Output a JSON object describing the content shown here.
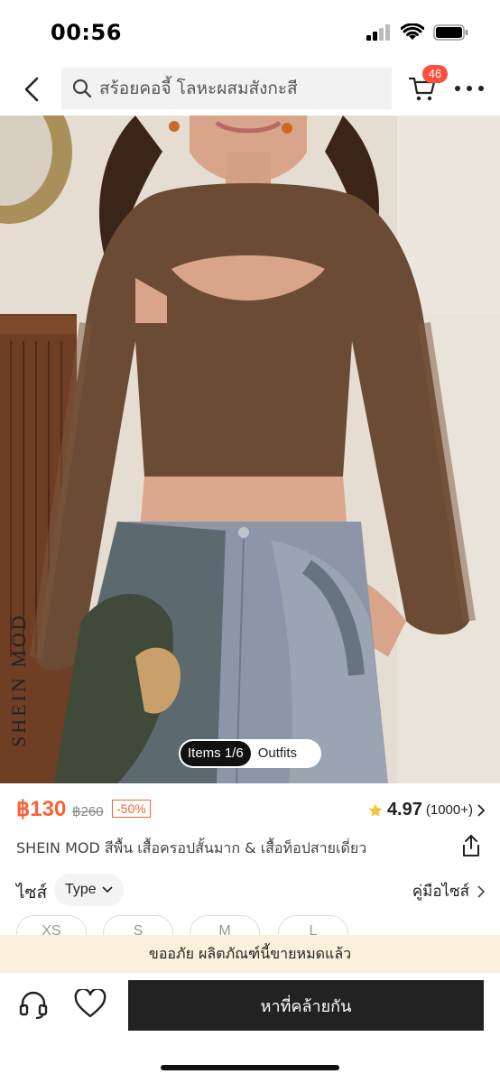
{
  "status_bar": {
    "time": "00:56"
  },
  "nav": {
    "search_placeholder": "สร้อยคอจี้ โลหะผสมสังกะสี",
    "cart_count": "46"
  },
  "hero": {
    "brand_watermark": "SHEIN MOD",
    "toggle_items": "Items 1/6",
    "toggle_outfits": "Outfits"
  },
  "product": {
    "price": "฿130",
    "original_price": "฿260",
    "discount": "-50%",
    "rating": "4.97",
    "review_count": "(1000+)",
    "title": "SHEIN MOD สีพื้น เสื้อครอปสั้นมาก & เสื้อท็อปสายเดี่ยว"
  },
  "size": {
    "label": "ไซส์",
    "type_dropdown": "Type",
    "guide_label": "คู่มือไซส์",
    "options": [
      "XS",
      "S",
      "M",
      "L"
    ]
  },
  "soldout_message": "ขออภัย ผลิตภัณฑ์นี้ขายหมดแล้ว",
  "actions": {
    "find_similar": "หาที่คล้ายกัน"
  },
  "colors": {
    "accent": "#fa6338",
    "badge": "#fa4f3d",
    "soldout_bg": "#fbf0db",
    "primary_button": "#222222"
  },
  "icons": [
    "signal-icon",
    "wifi-icon",
    "battery-icon",
    "back-icon",
    "search-icon",
    "cart-icon",
    "more-icon",
    "star-icon",
    "share-icon",
    "chevron-down-icon",
    "chevron-right-icon",
    "headset-icon",
    "heart-icon"
  ]
}
